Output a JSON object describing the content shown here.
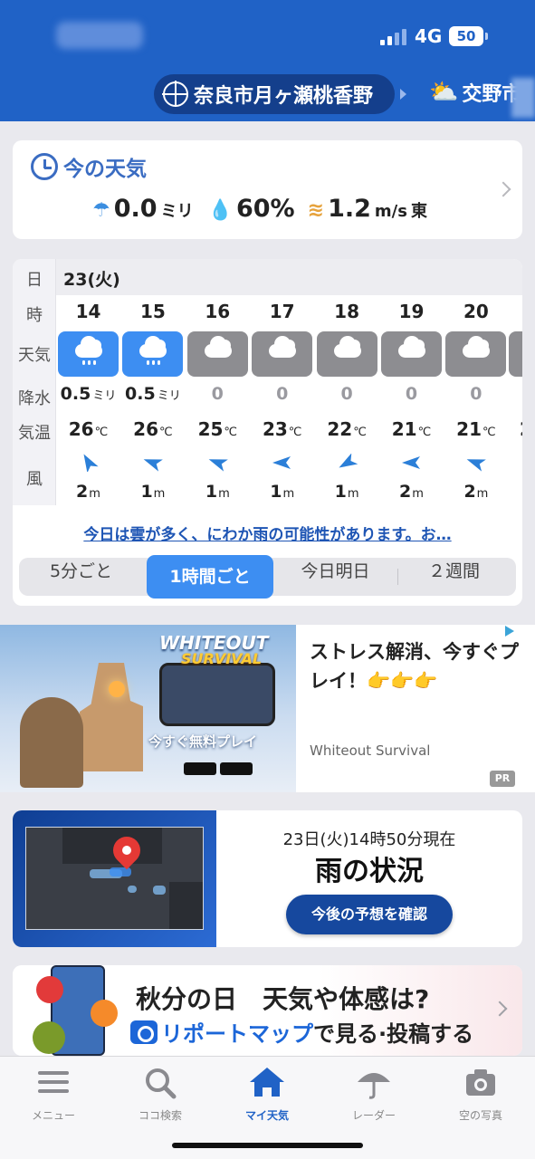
{
  "status_bar": {
    "network": "4G",
    "battery": "50"
  },
  "location": {
    "current": "奈良市月ヶ瀬桃香野",
    "next": "交野市"
  },
  "now_weather": {
    "title": "今の天気",
    "precip_value": "0.0",
    "precip_unit": "ミリ",
    "humidity": "60%",
    "wind_value": "1.2",
    "wind_unit": "m/s",
    "wind_dir": "東"
  },
  "hourly": {
    "labels": {
      "day": "日",
      "hour": "時",
      "weather": "天気",
      "precip": "降水",
      "temp": "気温",
      "wind": "風"
    },
    "day": "23(火)",
    "hours": [
      {
        "hour": "14",
        "weather": "rain",
        "precip": "0.5",
        "precip_unit": "ミリ",
        "temp": "26",
        "temp_unit": "℃",
        "wind_speed": "2",
        "wind_unit": "m",
        "wind_dir_deg": 330
      },
      {
        "hour": "15",
        "weather": "rain",
        "precip": "0.5",
        "precip_unit": "ミリ",
        "temp": "26",
        "temp_unit": "℃",
        "wind_speed": "1",
        "wind_unit": "m",
        "wind_dir_deg": 290
      },
      {
        "hour": "16",
        "weather": "cloudy",
        "precip": "0",
        "precip_unit": "",
        "temp": "25",
        "temp_unit": "℃",
        "wind_speed": "1",
        "wind_unit": "m",
        "wind_dir_deg": 290
      },
      {
        "hour": "17",
        "weather": "cloudy",
        "precip": "0",
        "precip_unit": "",
        "temp": "23",
        "temp_unit": "℃",
        "wind_speed": "1",
        "wind_unit": "m",
        "wind_dir_deg": 270
      },
      {
        "hour": "18",
        "weather": "cloudy",
        "precip": "0",
        "precip_unit": "",
        "temp": "22",
        "temp_unit": "℃",
        "wind_speed": "1",
        "wind_unit": "m",
        "wind_dir_deg": 240
      },
      {
        "hour": "19",
        "weather": "cloudy",
        "precip": "0",
        "precip_unit": "",
        "temp": "21",
        "temp_unit": "℃",
        "wind_speed": "2",
        "wind_unit": "m",
        "wind_dir_deg": 270
      },
      {
        "hour": "20",
        "weather": "cloudy",
        "precip": "0",
        "precip_unit": "",
        "temp": "21",
        "temp_unit": "℃",
        "wind_speed": "2",
        "wind_unit": "m",
        "wind_dir_deg": 290
      }
    ],
    "partial_temp": "2",
    "forecast_text": "今日は雲が多く、にわか雨の可能性があります。お…",
    "tabs": [
      "5分ごと",
      "1時間ごと",
      "今日明日",
      "２週間"
    ],
    "active_tab": 1
  },
  "ad": {
    "logo_top": "WHITEOUT",
    "logo_bottom": "SURVIVAL",
    "image_cta": "今すぐ無料プレイ",
    "text": "ストレス解消、今すぐプレイ！👉👉👉",
    "sponsor": "Whiteout Survival",
    "badge": "PR"
  },
  "rain_status": {
    "timestamp": "23日(火)14時50分現在",
    "title": "雨の状況",
    "button": "今後の予想を確認"
  },
  "promo": {
    "line1": "秋分の日　天気や体感は?",
    "highlight": "リポートマップ",
    "line2_rest": "で見る·投稿する"
  },
  "bottom_nav": [
    {
      "label": "メニュー",
      "icon": "menu-icon"
    },
    {
      "label": "ココ検索",
      "icon": "search-icon"
    },
    {
      "label": "マイ天気",
      "icon": "home-icon"
    },
    {
      "label": "レーダー",
      "icon": "umbrella-icon"
    },
    {
      "label": "空の写真",
      "icon": "camera-icon"
    }
  ],
  "colors": {
    "header": "#2062c6",
    "accent": "#3d8ef2",
    "rain_tile": "#3d8ef2",
    "cloud_tile": "#8d8d91",
    "link": "#1e55b4"
  }
}
